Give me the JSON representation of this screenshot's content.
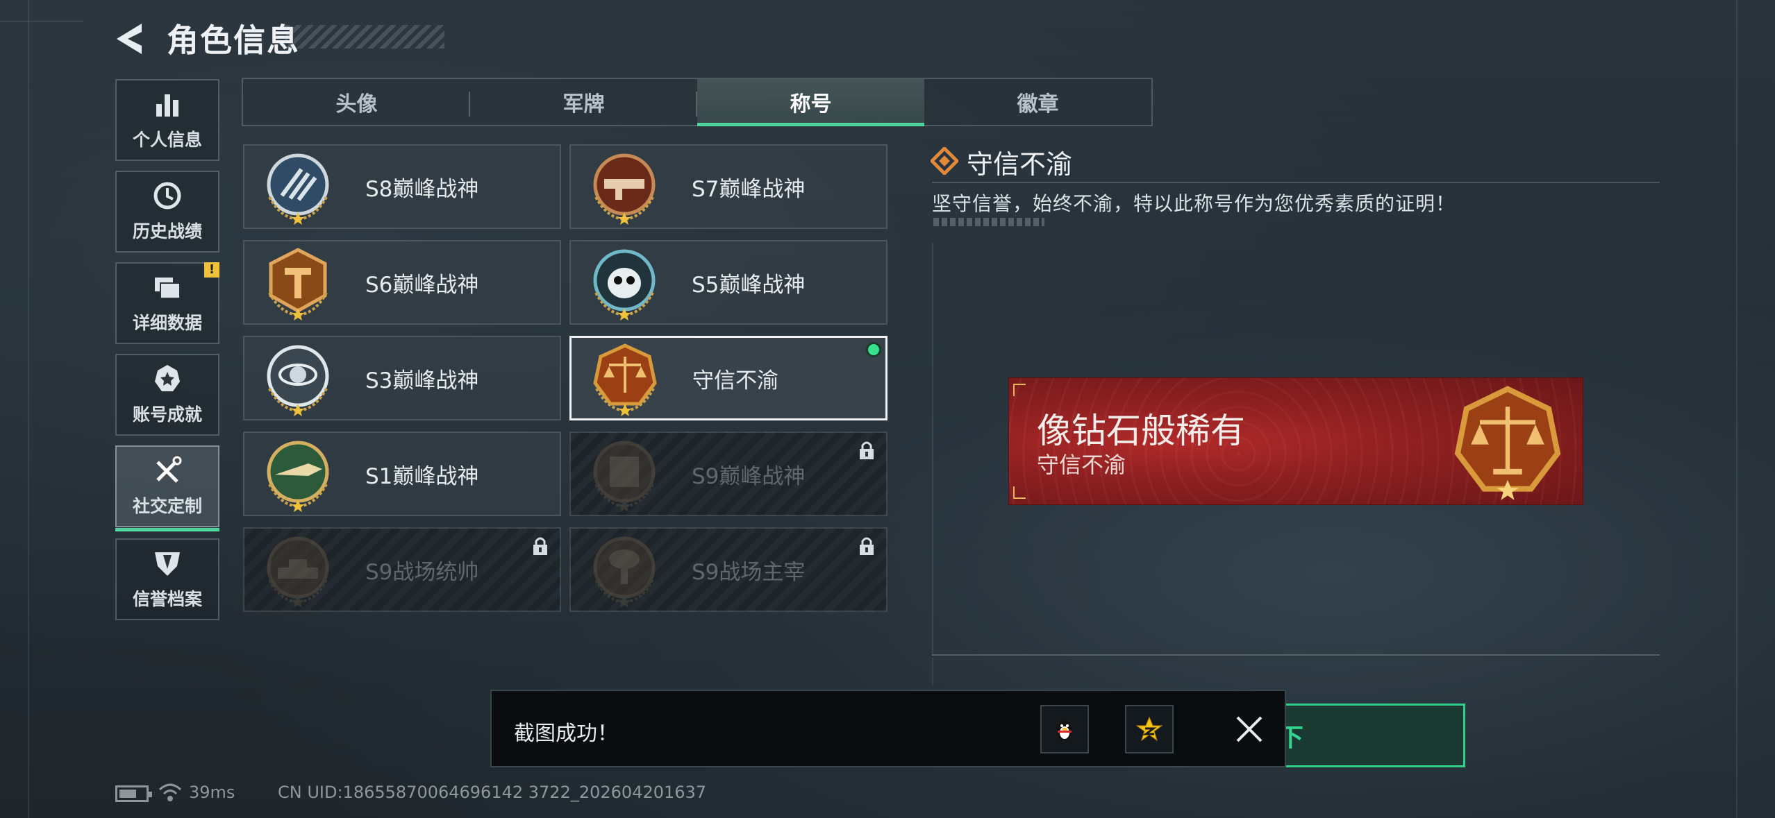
{
  "header": {
    "title": "角色信息"
  },
  "sidebar": {
    "items": [
      {
        "label": "个人信息",
        "icon": "bar-chart-icon"
      },
      {
        "label": "历史战绩",
        "icon": "clock-icon"
      },
      {
        "label": "详细数据",
        "icon": "folder-icon",
        "badge": "!"
      },
      {
        "label": "账号成就",
        "icon": "achievement-star-icon"
      },
      {
        "label": "社交定制",
        "icon": "tools-icon",
        "active": true
      },
      {
        "label": "信誉档案",
        "icon": "shield-icon"
      }
    ]
  },
  "tabs": [
    {
      "label": "头像"
    },
    {
      "label": "军牌"
    },
    {
      "label": "称号",
      "active": true
    },
    {
      "label": "徽章"
    }
  ],
  "titles": [
    {
      "name": "S8巅峰战神",
      "emblem": "s8-emblem",
      "locked": false
    },
    {
      "name": "S7巅峰战神",
      "emblem": "s7-emblem",
      "locked": false
    },
    {
      "name": "S6巅峰战神",
      "emblem": "s6-emblem",
      "locked": false
    },
    {
      "name": "S5巅峰战神",
      "emblem": "s5-emblem",
      "locked": false
    },
    {
      "name": "S3巅峰战神",
      "emblem": "s3-emblem",
      "locked": false
    },
    {
      "name": "守信不渝",
      "emblem": "scales-emblem",
      "locked": false,
      "selected": true
    },
    {
      "name": "S1巅峰战神",
      "emblem": "s1-emblem",
      "locked": false
    },
    {
      "name": "S9巅峰战神",
      "emblem": "s9-emblem",
      "locked": true
    },
    {
      "name": "S9战场统帅",
      "emblem": "tank-emblem",
      "locked": true
    },
    {
      "name": "S9战场主宰",
      "emblem": "explosion-emblem",
      "locked": true
    }
  ],
  "detail": {
    "title": "守信不渝",
    "description": "坚守信誉，始终不渝，特以此称号作为您优秀素质的证明！"
  },
  "banner": {
    "rarity": "像钻石般稀有",
    "name": "守信不渝"
  },
  "action": {
    "label": "卸下"
  },
  "toast": {
    "message": "截图成功！"
  },
  "status": {
    "ping": "39ms",
    "uid": "CN UID:18655870064696142 3722_202604201637"
  },
  "colors": {
    "accent": "#4fd59d",
    "banner_red": "#8c1f20",
    "gold": "#d89a3a",
    "warning": "#f0c23a"
  }
}
